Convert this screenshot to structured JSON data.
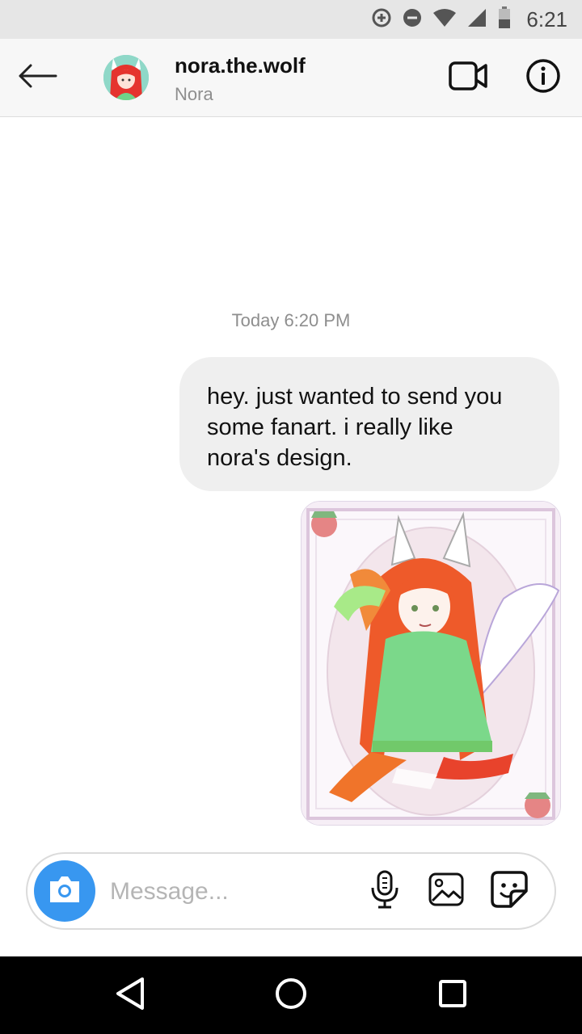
{
  "status_bar": {
    "time": "6:21",
    "icons": [
      "data-saver-icon",
      "do-not-disturb-icon",
      "wifi-icon",
      "signal-icon",
      "battery-icon"
    ]
  },
  "header": {
    "back_icon": "arrow-left-icon",
    "username": "nora.the.wolf",
    "display_name": "Nora",
    "video_icon": "video-camera-icon",
    "info_icon": "info-icon"
  },
  "conversation": {
    "timestamp": "Today 6:20 PM",
    "messages": [
      {
        "type": "text",
        "text": "hey. just wanted to send you some fanart. i really like nora's design."
      },
      {
        "type": "image"
      }
    ]
  },
  "composer": {
    "placeholder": "Message...",
    "camera_icon": "camera-icon",
    "mic_icon": "microphone-icon",
    "gallery_icon": "image-icon",
    "sticker_icon": "sticker-icon"
  },
  "nav_bar": {
    "icons": [
      "back-triangle-icon",
      "home-circle-icon",
      "recents-square-icon"
    ]
  },
  "colors": {
    "accent": "#3897f0",
    "bubble": "#efefef",
    "status_bar": "#e6e6e6",
    "header": "#f7f7f7"
  }
}
